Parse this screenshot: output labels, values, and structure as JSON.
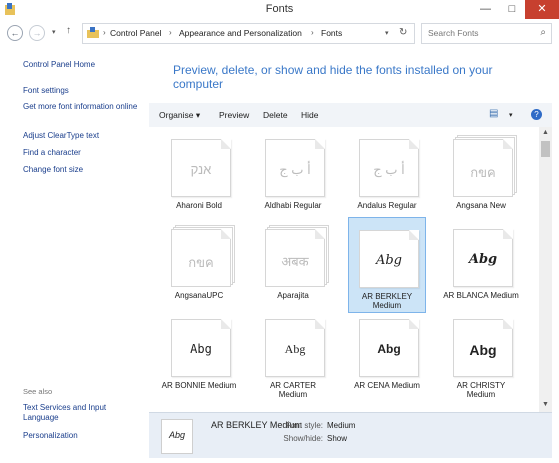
{
  "window": {
    "title": "Fonts",
    "minimize": "—",
    "maximize": "□",
    "close": "✕"
  },
  "nav": {
    "back": "←",
    "forward": "→",
    "dropdown": "▾",
    "up": "↑",
    "refresh": "↻",
    "address_dropdown": "▾"
  },
  "address": {
    "crumbs": [
      "Control Panel",
      "Appearance and Personalization",
      "Fonts"
    ],
    "sep": "›"
  },
  "search": {
    "placeholder": "Search Fonts",
    "icon": "⌕"
  },
  "sidebar": {
    "links": [
      "Control Panel Home",
      "Font settings",
      "Get more font information online",
      "Adjust ClearType text",
      "Find a character",
      "Change font size"
    ],
    "see_also": "See also",
    "see_also_links": [
      "Text Services and Input Language",
      "Personalization"
    ]
  },
  "headline": "Preview, delete, or show and hide the fonts installed on your computer",
  "toolbar": {
    "organise": "Organise ▾",
    "preview": "Preview",
    "delete": "Delete",
    "hide": "Hide",
    "view_icon": "▤",
    "view_dropdown": "▾",
    "help_icon": "?"
  },
  "fonts": [
    {
      "name": "Aharoni Bold",
      "sample": "אנק",
      "faded": true,
      "stack": false,
      "selected": false
    },
    {
      "name": "Aldhabi Regular",
      "sample": "أ ب ج",
      "faded": true,
      "stack": false,
      "selected": false
    },
    {
      "name": "Andalus Regular",
      "sample": "أ ب ج",
      "faded": true,
      "stack": false,
      "selected": false
    },
    {
      "name": "Angsana New",
      "sample": "กขค",
      "faded": true,
      "stack": true,
      "selected": false
    },
    {
      "name": "AngsanaUPC",
      "sample": "กขค",
      "faded": true,
      "stack": true,
      "selected": false
    },
    {
      "name": "Aparajita",
      "sample": "अबक",
      "faded": true,
      "stack": true,
      "selected": false
    },
    {
      "name": "AR BERKLEY Medium",
      "sample": "Abg",
      "faded": false,
      "stack": false,
      "selected": true
    },
    {
      "name": "AR BLANCA Medium",
      "sample": "Abg",
      "faded": false,
      "stack": false,
      "selected": false
    },
    {
      "name": "AR BONNIE Medium",
      "sample": "Abg",
      "faded": false,
      "stack": false,
      "selected": false
    },
    {
      "name": "AR CARTER Medium",
      "sample": "Abg",
      "faded": false,
      "stack": false,
      "selected": false
    },
    {
      "name": "AR CENA Medium",
      "sample": "Abg",
      "faded": false,
      "stack": false,
      "selected": false
    },
    {
      "name": "AR CHRISTY Medium",
      "sample": "Abg",
      "faded": false,
      "stack": false,
      "selected": false
    }
  ],
  "scroll": {
    "up": "▲",
    "down": "▼"
  },
  "details": {
    "thumb_sample": "Abg",
    "name": "AR BERKLEY Medium",
    "style_label": "Font style:",
    "style_value": "Medium",
    "showhide_label": "Show/hide:",
    "showhide_value": "Show"
  }
}
